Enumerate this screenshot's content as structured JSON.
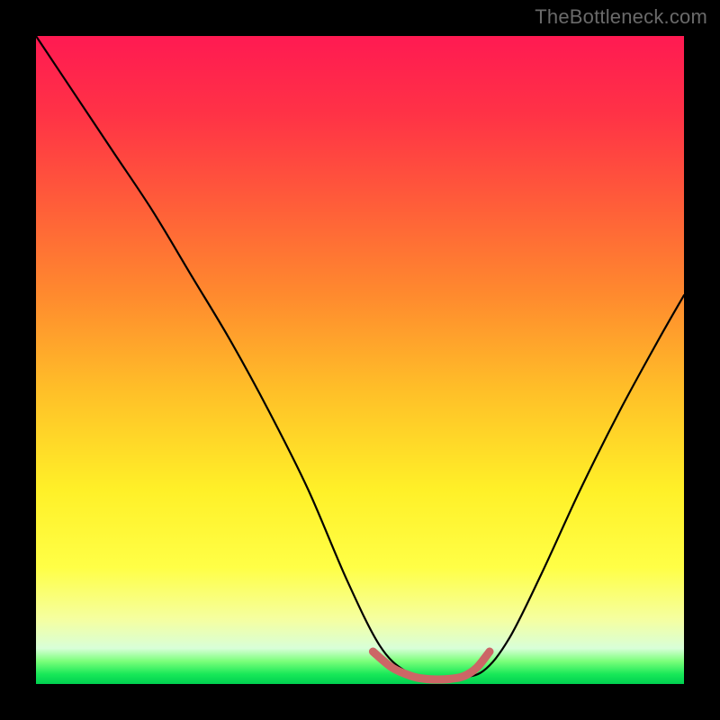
{
  "watermark": "TheBottleneck.com",
  "gradient_stops": [
    {
      "offset": 0,
      "color": "#ff1a52"
    },
    {
      "offset": 0.12,
      "color": "#ff3246"
    },
    {
      "offset": 0.25,
      "color": "#ff5a3a"
    },
    {
      "offset": 0.4,
      "color": "#ff8a2e"
    },
    {
      "offset": 0.55,
      "color": "#ffc028"
    },
    {
      "offset": 0.7,
      "color": "#fff028"
    },
    {
      "offset": 0.82,
      "color": "#ffff46"
    },
    {
      "offset": 0.9,
      "color": "#f5ffa0"
    },
    {
      "offset": 0.945,
      "color": "#d8ffd8"
    },
    {
      "offset": 0.965,
      "color": "#7aff7a"
    },
    {
      "offset": 0.985,
      "color": "#18e858"
    },
    {
      "offset": 1.0,
      "color": "#00d050"
    }
  ],
  "chart_data": {
    "type": "line",
    "title": "",
    "xlabel": "",
    "ylabel": "",
    "xlim": [
      0,
      100
    ],
    "ylim": [
      0,
      100
    ],
    "categories_note": "x runs 0..100 left-to-right; y runs 0 (bottom, green, ideal) to 100 (top, red, bottleneck)",
    "series": [
      {
        "name": "bottleneck-curve",
        "x": [
          0,
          6,
          12,
          18,
          24,
          30,
          36,
          42,
          48,
          53,
          57,
          61,
          65,
          69,
          73,
          78,
          84,
          90,
          96,
          100
        ],
        "values": [
          100,
          91,
          82,
          73,
          63,
          53,
          42,
          30,
          16,
          6,
          2,
          1,
          1,
          2,
          7,
          17,
          30,
          42,
          53,
          60
        ]
      },
      {
        "name": "optimal-region-highlight",
        "x": [
          52,
          55,
          58,
          60,
          62,
          64,
          66,
          68,
          70
        ],
        "values": [
          5,
          2.5,
          1.2,
          0.8,
          0.7,
          0.8,
          1.2,
          2.5,
          5
        ]
      }
    ],
    "colors": {
      "curve": "#000000",
      "optimal_highlight": "#cc6666"
    }
  }
}
